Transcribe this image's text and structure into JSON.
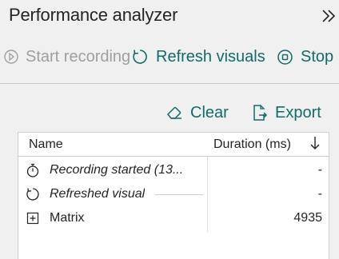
{
  "header": {
    "title": "Performance analyzer",
    "collapse_icon": "double-chevron-right-icon"
  },
  "toolbar": {
    "start_label": "Start recording",
    "refresh_label": "Refresh visuals",
    "stop_label": "Stop"
  },
  "actions": {
    "clear_label": "Clear",
    "export_label": "Export"
  },
  "table": {
    "columns": {
      "name": "Name",
      "duration": "Duration (ms)"
    },
    "sort": "descending",
    "rows": [
      {
        "name": "Recording started (13...",
        "duration": "-",
        "icon": "stopwatch-icon"
      },
      {
        "name": "Refreshed visual",
        "duration": "-",
        "icon": "refresh-icon"
      },
      {
        "name": "Matrix",
        "duration": "4935",
        "icon": "expand-icon"
      }
    ]
  },
  "colors": {
    "accent": "#106c6a",
    "disabled": "#a19f9d",
    "text": "#252423",
    "background": "#f0f0f0"
  }
}
